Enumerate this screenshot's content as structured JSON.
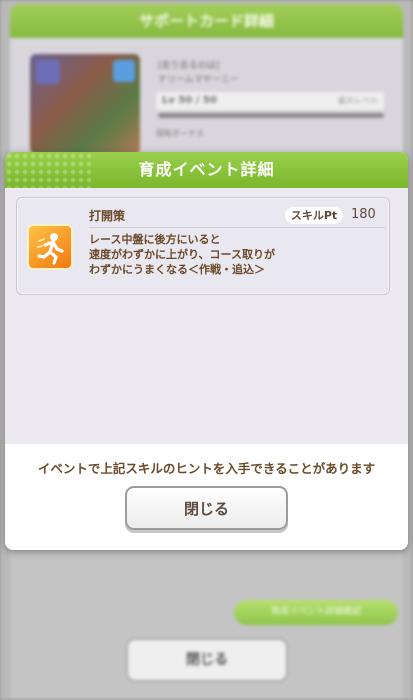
{
  "background": {
    "header_title": "サポートカード詳細",
    "card_line1": "[走り去るのは]",
    "card_line2": "ナリームマヤーニー",
    "level_text": "Lv 50 / 50",
    "level_note": "最大レベル",
    "bonus_text": "固有ボーナス",
    "green_button_label": "育成イベント詳細確認",
    "close_label": "閉じる"
  },
  "dialog": {
    "title": "育成イベント詳細",
    "skill": {
      "name": "打開策",
      "pt_label": "スキルPt",
      "pt_value": "180",
      "description_lines": [
        "レース中盤に後方にいると",
        "速度がわずかに上がり、コース取りが",
        "わずかにうまくなる＜作戦・追込＞"
      ]
    },
    "notice": "イベントで上記スキルのヒントを入手できることがあります",
    "close_label": "閉じる"
  },
  "colors": {
    "header_green": "#86bd3c",
    "text_brown": "#6b4a2a",
    "skill_icon_orange": "#f59a1f"
  },
  "icons": {
    "skill_icon": "running-figure-icon"
  }
}
